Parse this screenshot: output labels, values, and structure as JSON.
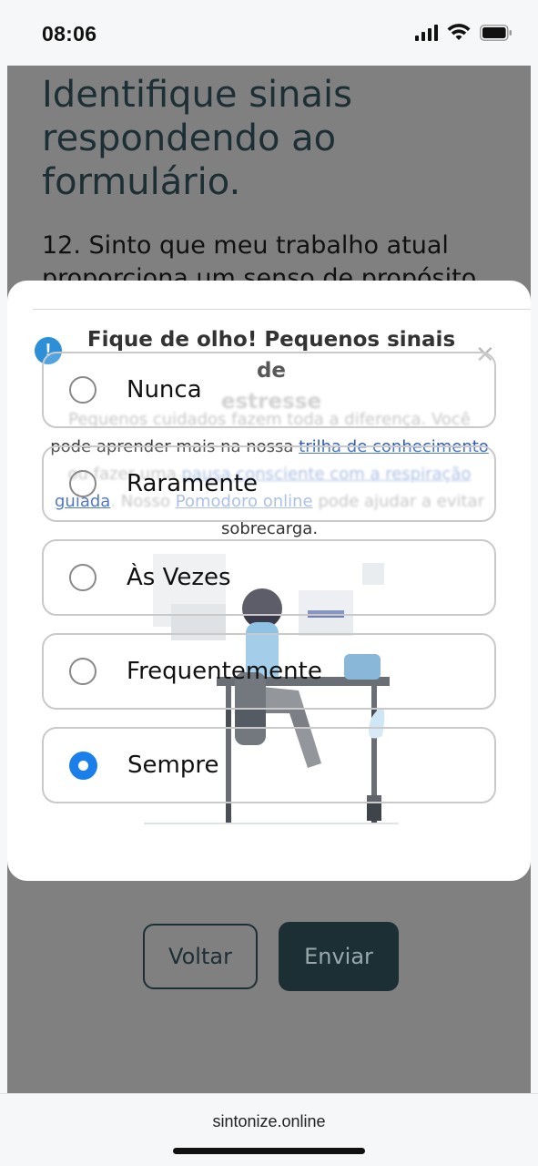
{
  "status_bar": {
    "time": "08:06"
  },
  "page": {
    "title": "Identifique sinais respondendo ao formulário.",
    "question": "12. Sinto que meu trabalho atual proporciona um senso de propósito",
    "back_label": "Voltar",
    "send_label": "Enviar"
  },
  "modal": {
    "title_line1": "Fique de olho! Pequenos sinais de",
    "title_line2": "estresse",
    "text_line1_blur": "Pequenos cuidados fazem toda a diferença. Você",
    "text_line2_a": "pode aprender mais na nossa ",
    "text_link1": "trilha de conhecimento",
    "text_line3_blur_a": "ou fazer uma ",
    "text_link2": "pausa consciente com a respiração",
    "text_link2b": "guiada",
    "text_line4_a": ". Nosso ",
    "text_link3": "Pomodoro online",
    "text_line4_b": " pode ajudar a evitar",
    "text_line5": "sobrecarga."
  },
  "options": [
    {
      "label": "Nunca",
      "selected": false
    },
    {
      "label": "Raramente",
      "selected": false
    },
    {
      "label": "Às Vezes",
      "selected": false
    },
    {
      "label": "Frequentemente",
      "selected": false
    },
    {
      "label": "Sempre",
      "selected": true
    }
  ],
  "browser": {
    "url": "sintonize.online"
  },
  "colors": {
    "accent": "#1a7fea",
    "dark_teal": "#1c2f34",
    "overlay": "#808080"
  }
}
